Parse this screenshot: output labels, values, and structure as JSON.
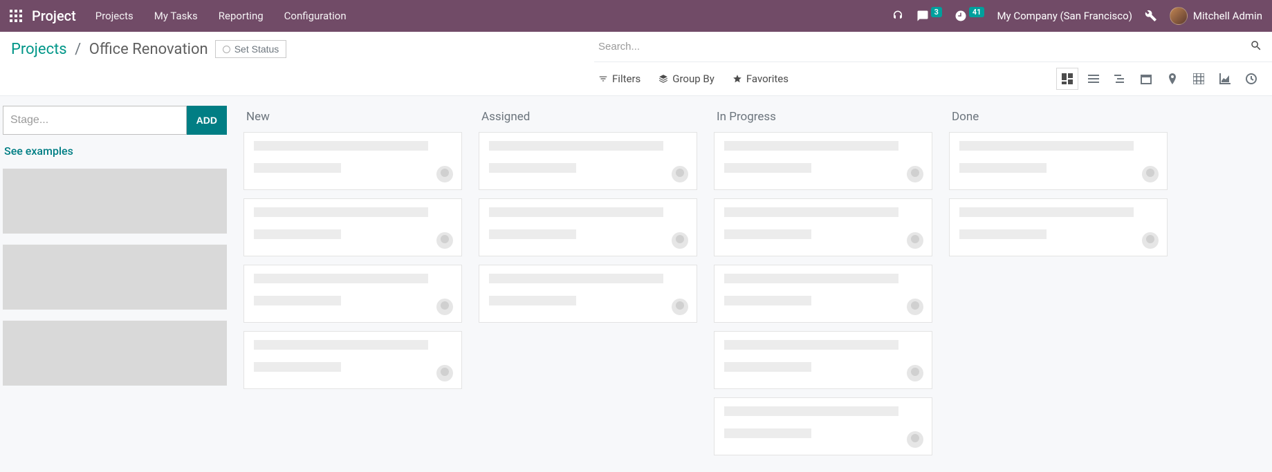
{
  "top_nav": {
    "brand": "Project",
    "menu": [
      "Projects",
      "My Tasks",
      "Reporting",
      "Configuration"
    ],
    "messages_badge": "3",
    "activities_badge": "41",
    "company": "My Company (San Francisco)",
    "user_name": "Mitchell Admin"
  },
  "breadcrumb": {
    "root": "Projects",
    "sep": "/",
    "current": "Office Renovation"
  },
  "status_button": "Set Status",
  "search": {
    "placeholder": "Search..."
  },
  "toolbar": {
    "filters": "Filters",
    "group_by": "Group By",
    "favorites": "Favorites"
  },
  "stage_column": {
    "input_placeholder": "Stage...",
    "add_label": "ADD",
    "see_examples": "See examples",
    "empty_blocks": 3
  },
  "kanban_columns": [
    {
      "title": "New",
      "cards": 4
    },
    {
      "title": "Assigned",
      "cards": 3
    },
    {
      "title": "In Progress",
      "cards": 5
    },
    {
      "title": "Done",
      "cards": 2
    }
  ]
}
